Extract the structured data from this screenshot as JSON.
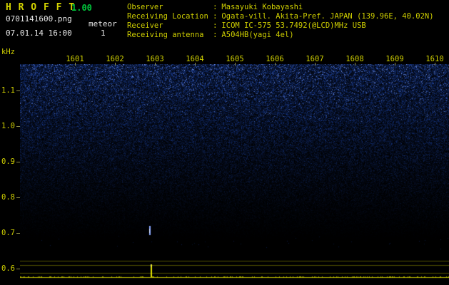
{
  "colors": {
    "background": "#000000",
    "text_yellow": "#cfcf00",
    "text_green": "#00c83c",
    "text_white": "#e8e8e8",
    "noise_blue": "#2244cc",
    "trace_yellow": "#b4b400"
  },
  "header": {
    "title": "H R O F F T",
    "version": "1.00",
    "filename": "0701141600.png",
    "mode": "meteor",
    "count": "1",
    "datetime": "07.01.14 16:00"
  },
  "info": {
    "separator": ":",
    "rows": [
      {
        "label": "Observer",
        "value": "Masayuki Kobayashi"
      },
      {
        "label": "Receiving Location",
        "value": "Ogata-vill. Akita-Pref. JAPAN (139.96E, 40.02N)"
      },
      {
        "label": "Receiver",
        "value": "ICOM IC-575 53.7492(@LCD)MHz USB"
      },
      {
        "label": "Receiving antenna",
        "value": "A504HB(yagi 4el)"
      }
    ]
  },
  "chart_data": {
    "type": "heatmap",
    "description": "10-minute radio meteor spectrogram: blue background noise, brightest at top and fading to black toward the bottom; yellow signal-level trace with reference lines along the bottom strip; one meteor echo streak with matching level spike",
    "x_axis": {
      "unit": "time (HHMM)",
      "ticks": [
        "1601",
        "1602",
        "1603",
        "1604",
        "1605",
        "1606",
        "1607",
        "1608",
        "1609",
        "1610"
      ]
    },
    "y_axis": {
      "unit": "kHz",
      "ticks": [
        "1.1",
        "1.0",
        "0.9",
        "0.8",
        "0.7",
        "0.6"
      ],
      "range_khz": [
        0.56,
        1.17
      ]
    },
    "meteor_echoes": [
      {
        "time_min": 2.85,
        "freq_khz": 0.72
      }
    ],
    "meteor_count": 1,
    "legend": "none",
    "grid": "off"
  }
}
